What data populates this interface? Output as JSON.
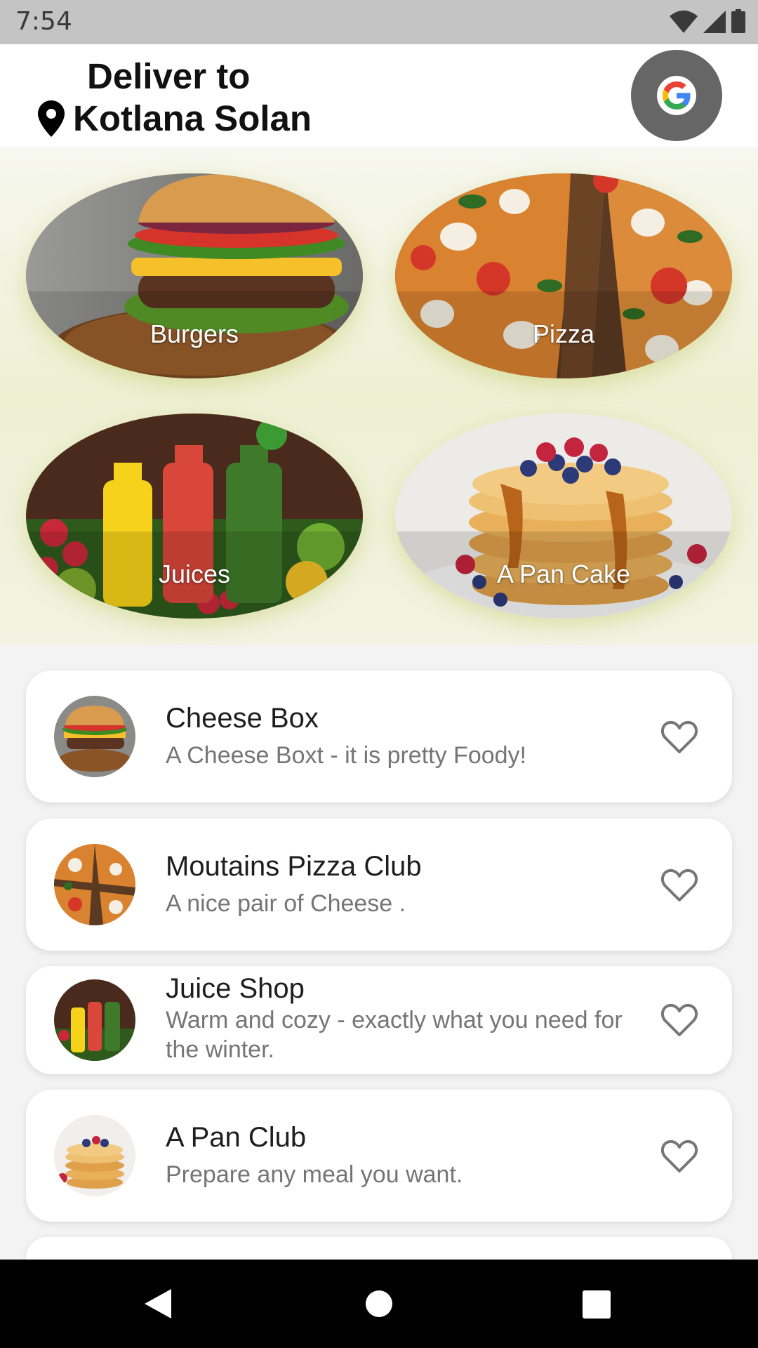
{
  "status": {
    "time": "7:54"
  },
  "header": {
    "deliver_label": "Deliver to",
    "location": "Kotlana Solan",
    "profile_icon": "google-icon"
  },
  "categories": [
    {
      "label": "Burgers"
    },
    {
      "label": "Pizza"
    },
    {
      "label": "Juices"
    },
    {
      "label": "A Pan Cake"
    }
  ],
  "restaurants": [
    {
      "name": "Cheese Box",
      "description": "A Cheese Boxt - it is pretty Foody!"
    },
    {
      "name": "Moutains Pizza Club",
      "description": "A nice pair of Cheese ."
    },
    {
      "name": "Juice Shop",
      "description": "Warm and cozy - exactly what you need for the winter."
    },
    {
      "name": "A Pan Club",
      "description": "Prepare any meal you want."
    }
  ],
  "colors": {
    "accent_glow": "#e7ebb4",
    "header_bg": "#ffffff",
    "avatar_bg": "#666666"
  }
}
